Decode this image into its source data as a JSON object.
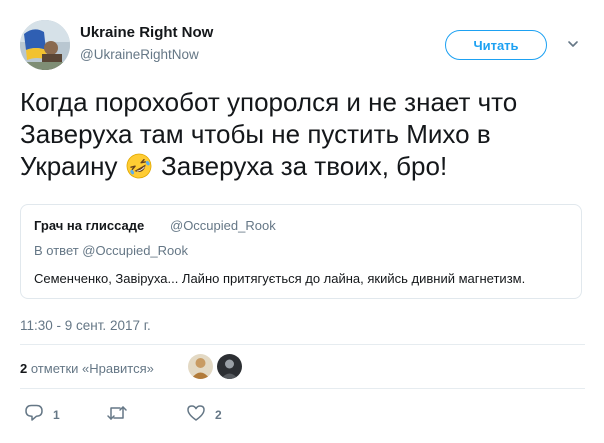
{
  "header": {
    "display_name": "Ukraine Right Now",
    "handle": "@UkraineRightNow",
    "follow_label": "Читать"
  },
  "tweet": {
    "text_before_emoji": "Когда порохобот упоролся и не знает что Заверуха там чтобы не пустить Михо в Украину",
    "emoji": "rolling-on-the-floor-laughing-emoji",
    "text_after_emoji": "Заверуха за твоих, бро!"
  },
  "quoted_tweet": {
    "name": "Грач на глиссаде",
    "handle": "@Occupied_Rook",
    "reply_to": "В ответ @Occupied_Rook",
    "text": "Семенченко, Завіруха... Лайно притягується до лайна, якийсь дивний магнетизм."
  },
  "timestamp": "11:30 - 9 сент. 2017 г.",
  "stats": {
    "likes_count": "2",
    "likes_label": "отметки «Нравится»"
  },
  "actions": {
    "reply_count": "1",
    "retweet_count": "",
    "like_count": "2"
  },
  "colors": {
    "accent": "#1da1f2",
    "secondary_text": "#657786",
    "border": "#e1e8ed"
  }
}
